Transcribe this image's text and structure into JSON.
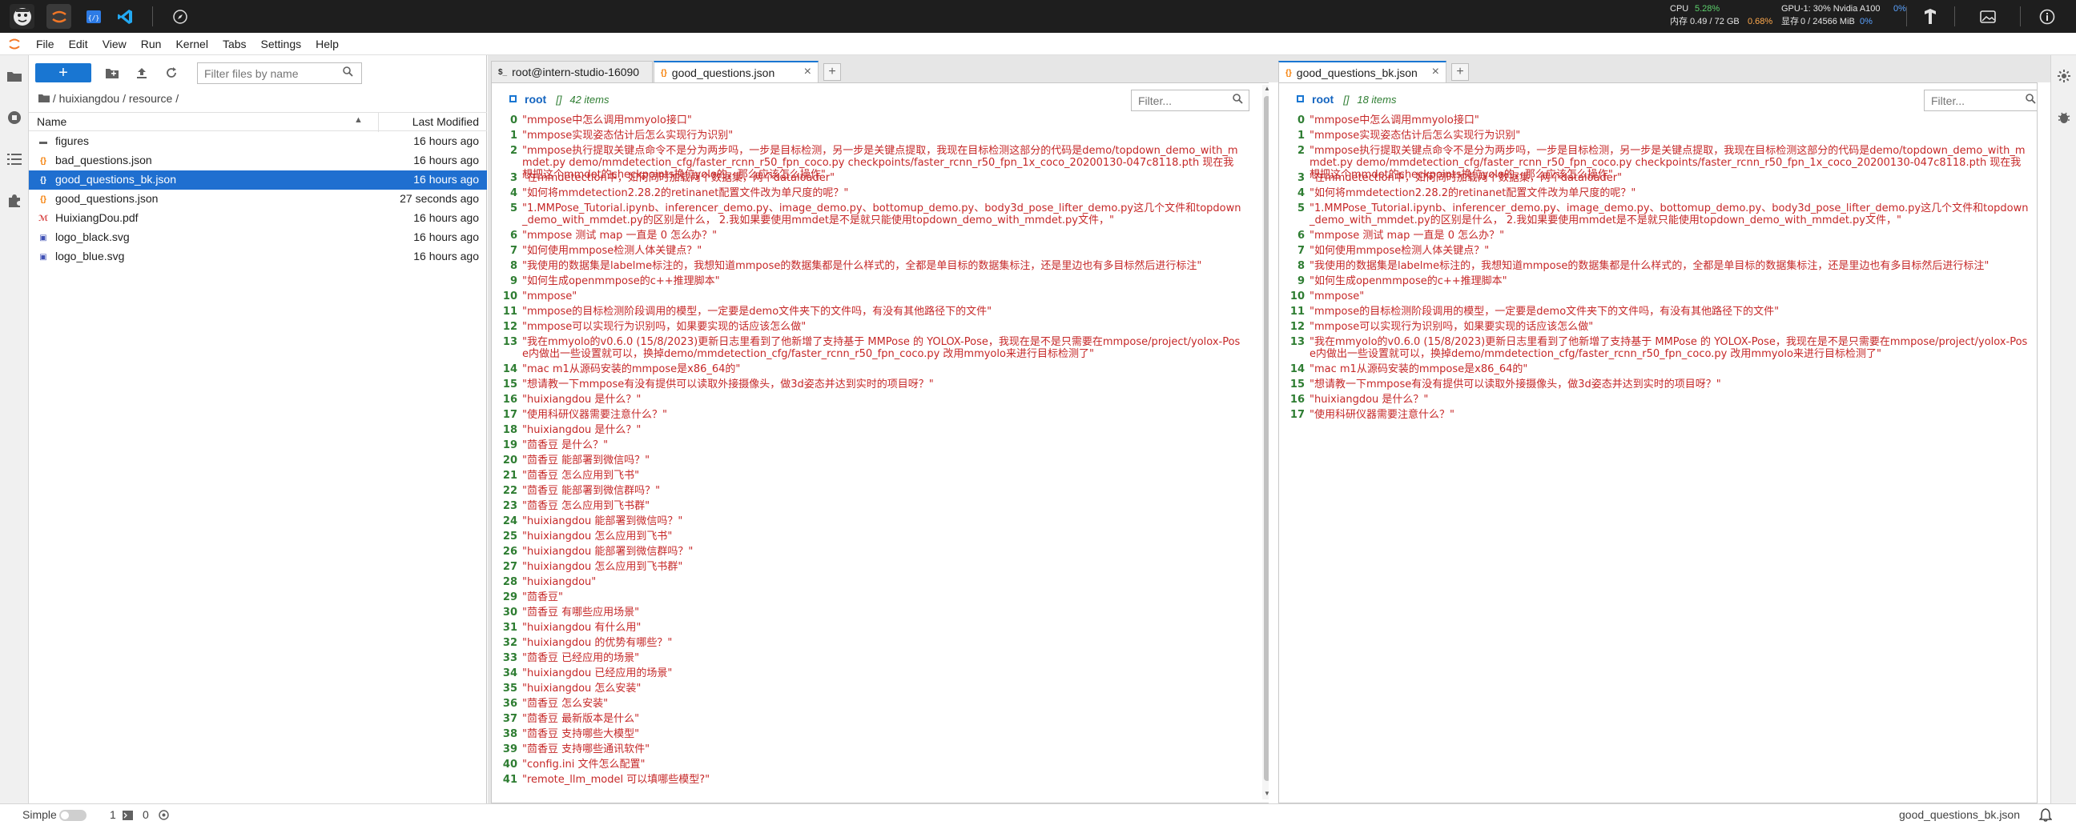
{
  "system_stats": {
    "cpu_label": "CPU",
    "cpu_value": "5.28%",
    "mem_label": "内存",
    "mem_value": "0.49 / 72 GB",
    "mem_percent": "0.68%",
    "gpu_label": "GPU-1: 30% Nvidia A100",
    "gpu_percent": "0%",
    "vram_label": "显存",
    "vram_value": "0 / 24566 MiB",
    "vram_percent": "0%"
  },
  "menu": [
    "File",
    "Edit",
    "View",
    "Run",
    "Kernel",
    "Tabs",
    "Settings",
    "Help"
  ],
  "file_browser": {
    "new_label": "+",
    "filter_placeholder": "Filter files by name",
    "breadcrumb": "/ huixiangdou / resource /",
    "col_name": "Name",
    "col_modified": "Last Modified",
    "files": [
      {
        "name": "figures",
        "modified": "16 hours ago",
        "icon": "folder-icon",
        "glyph": "▬"
      },
      {
        "name": "bad_questions.json",
        "modified": "16 hours ago",
        "icon": "json-file-icon",
        "glyph": "{}"
      },
      {
        "name": "good_questions_bk.json",
        "modified": "16 hours ago",
        "icon": "json-file-icon",
        "glyph": "{}"
      },
      {
        "name": "good_questions.json",
        "modified": "27 seconds ago",
        "icon": "json-file-icon",
        "glyph": "{}"
      },
      {
        "name": "HuixiangDou.pdf",
        "modified": "16 hours ago",
        "icon": "pdf-file-icon",
        "glyph": "ℳ"
      },
      {
        "name": "logo_black.svg",
        "modified": "16 hours ago",
        "icon": "image-file-icon",
        "glyph": "▣"
      },
      {
        "name": "logo_blue.svg",
        "modified": "16 hours ago",
        "icon": "image-file-icon",
        "glyph": "▣"
      }
    ]
  },
  "left_panel": {
    "tabs": [
      {
        "label": "root@intern-studio-16090",
        "icon": "$_"
      },
      {
        "label": "good_questions.json",
        "icon": "{}"
      }
    ],
    "filter_placeholder": "Filter...",
    "root_key": "root",
    "root_type": "[]",
    "root_count": "42 items",
    "items": [
      {
        "k": "0",
        "v": "\"mmpose中怎么调用mmyolo接口\""
      },
      {
        "k": "1",
        "v": "\"mmpose实现姿态估计后怎么实现行为识别\""
      },
      {
        "k": "2",
        "v": "\"mmpose执行提取关键点命令不是分为两步吗，一步是目标检测，另一步是关键点提取，我现在目标检测这部分的代码是demo/topdown_demo_with_mmdet.py demo/mmdetection_cfg/faster_rcnn_r50_fpn_coco.py checkpoints/faster_rcnn_r50_fpn_1x_coco_20200130-047c8118.pth 现在我想把这个mmdet的checkpoints换位yolo的，那么应该怎么操作\""
      },
      {
        "k": "3",
        "v": "\"在mmdetection中，如何同时加载两个数据集，两个dataloader\""
      },
      {
        "k": "4",
        "v": "\"如何将mmdetection2.28.2的retinanet配置文件改为单尺度的呢？\""
      },
      {
        "k": "5",
        "v": "\"1.MMPose_Tutorial.ipynb、inferencer_demo.py、image_demo.py、bottomup_demo.py、body3d_pose_lifter_demo.py这几个文件和topdown_demo_with_mmdet.py的区别是什么， 2.我如果要使用mmdet是不是就只能使用topdown_demo_with_mmdet.py文件，\""
      },
      {
        "k": "6",
        "v": "\"mmpose 测试 map 一直是 0 怎么办？\""
      },
      {
        "k": "7",
        "v": "\"如何使用mmpose检测人体关键点？\""
      },
      {
        "k": "8",
        "v": "\"我使用的数据集是labelme标注的，我想知道mmpose的数据集都是什么样式的，全都是单目标的数据集标注，还是里边也有多目标然后进行标注\""
      },
      {
        "k": "9",
        "v": "\"如何生成openmmpose的c++推理脚本\""
      },
      {
        "k": "10",
        "v": "\"mmpose\""
      },
      {
        "k": "11",
        "v": "\"mmpose的目标检测阶段调用的模型，一定要是demo文件夹下的文件吗，有没有其他路径下的文件\""
      },
      {
        "k": "12",
        "v": "\"mmpose可以实现行为识别吗，如果要实现的话应该怎么做\""
      },
      {
        "k": "13",
        "v": "\"我在mmyolo的v0.6.0 (15/8/2023)更新日志里看到了他新增了支持基于 MMPose 的 YOLOX-Pose，我现在是不是只需要在mmpose/project/yolox-Pose内做出一些设置就可以，换掉demo/mmdetection_cfg/faster_rcnn_r50_fpn_coco.py 改用mmyolo来进行目标检测了\""
      },
      {
        "k": "14",
        "v": "\"mac m1从源码安装的mmpose是x86_64的\""
      },
      {
        "k": "15",
        "v": "\"想请教一下mmpose有没有提供可以读取外接摄像头，做3d姿态并达到实时的项目呀？\""
      },
      {
        "k": "16",
        "v": "\"huixiangdou 是什么？\""
      },
      {
        "k": "17",
        "v": "\"使用科研仪器需要注意什么？\""
      },
      {
        "k": "18",
        "v": "\"huixiangdou 是什么？\""
      },
      {
        "k": "19",
        "v": "\"茴香豆 是什么？\""
      },
      {
        "k": "20",
        "v": "\"茴香豆 能部署到微信吗？\""
      },
      {
        "k": "21",
        "v": "\"茴香豆 怎么应用到飞书\""
      },
      {
        "k": "22",
        "v": "\"茴香豆 能部署到微信群吗？\""
      },
      {
        "k": "23",
        "v": "\"茴香豆 怎么应用到飞书群\""
      },
      {
        "k": "24",
        "v": "\"huixiangdou 能部署到微信吗？\""
      },
      {
        "k": "25",
        "v": "\"huixiangdou 怎么应用到飞书\""
      },
      {
        "k": "26",
        "v": "\"huixiangdou 能部署到微信群吗？\""
      },
      {
        "k": "27",
        "v": "\"huixiangdou 怎么应用到飞书群\""
      },
      {
        "k": "28",
        "v": "\"huixiangdou\""
      },
      {
        "k": "29",
        "v": "\"茴香豆\""
      },
      {
        "k": "30",
        "v": "\"茴香豆 有哪些应用场景\""
      },
      {
        "k": "31",
        "v": "\"huixiangdou 有什么用\""
      },
      {
        "k": "32",
        "v": "\"huixiangdou 的优势有哪些？\""
      },
      {
        "k": "33",
        "v": "\"茴香豆 已经应用的场景\""
      },
      {
        "k": "34",
        "v": "\"huixiangdou 已经应用的场景\""
      },
      {
        "k": "35",
        "v": "\"huixiangdou 怎么安装\""
      },
      {
        "k": "36",
        "v": "\"茴香豆 怎么安装\""
      },
      {
        "k": "37",
        "v": "\"茴香豆 最新版本是什么\""
      },
      {
        "k": "38",
        "v": "\"茴香豆 支持哪些大模型\""
      },
      {
        "k": "39",
        "v": "\"茴香豆 支持哪些通讯软件\""
      },
      {
        "k": "40",
        "v": "\"config.ini 文件怎么配置\""
      },
      {
        "k": "41",
        "v": "\"remote_llm_model 可以填哪些模型?\""
      }
    ]
  },
  "right_panel": {
    "tabs": [
      {
        "label": "good_questions_bk.json",
        "icon": "{}"
      }
    ],
    "filter_placeholder": "Filter...",
    "root_key": "root",
    "root_type": "[]",
    "root_count": "18 items",
    "items": [
      {
        "k": "0",
        "v": "\"mmpose中怎么调用mmyolo接口\""
      },
      {
        "k": "1",
        "v": "\"mmpose实现姿态估计后怎么实现行为识别\""
      },
      {
        "k": "2",
        "v": "\"mmpose执行提取关键点命令不是分为两步吗，一步是目标检测，另一步是关键点提取，我现在目标检测这部分的代码是demo/topdown_demo_with_mmdet.py demo/mmdetection_cfg/faster_rcnn_r50_fpn_coco.py checkpoints/faster_rcnn_r50_fpn_1x_coco_20200130-047c8118.pth 现在我想把这个mmdet的checkpoints换位yolo的，那么应该怎么操作\""
      },
      {
        "k": "3",
        "v": "\"在mmdetection中，如何同时加载两个数据集，两个dataloader\""
      },
      {
        "k": "4",
        "v": "\"如何将mmdetection2.28.2的retinanet配置文件改为单尺度的呢？\""
      },
      {
        "k": "5",
        "v": "\"1.MMPose_Tutorial.ipynb、inferencer_demo.py、image_demo.py、bottomup_demo.py、body3d_pose_lifter_demo.py这几个文件和topdown_demo_with_mmdet.py的区别是什么， 2.我如果要使用mmdet是不是就只能使用topdown_demo_with_mmdet.py文件，\""
      },
      {
        "k": "6",
        "v": "\"mmpose 测试 map 一直是 0 怎么办？\""
      },
      {
        "k": "7",
        "v": "\"如何使用mmpose检测人体关键点？\""
      },
      {
        "k": "8",
        "v": "\"我使用的数据集是labelme标注的，我想知道mmpose的数据集都是什么样式的，全都是单目标的数据集标注，还是里边也有多目标然后进行标注\""
      },
      {
        "k": "9",
        "v": "\"如何生成openmmpose的c++推理脚本\""
      },
      {
        "k": "10",
        "v": "\"mmpose\""
      },
      {
        "k": "11",
        "v": "\"mmpose的目标检测阶段调用的模型，一定要是demo文件夹下的文件吗，有没有其他路径下的文件\""
      },
      {
        "k": "12",
        "v": "\"mmpose可以实现行为识别吗，如果要实现的话应该怎么做\""
      },
      {
        "k": "13",
        "v": "\"我在mmyolo的v0.6.0 (15/8/2023)更新日志里看到了他新增了支持基于 MMPose 的 YOLOX-Pose，我现在是不是只需要在mmpose/project/yolox-Pose内做出一些设置就可以，换掉demo/mmdetection_cfg/faster_rcnn_r50_fpn_coco.py 改用mmyolo来进行目标检测了\""
      },
      {
        "k": "14",
        "v": "\"mac m1从源码安装的mmpose是x86_64的\""
      },
      {
        "k": "15",
        "v": "\"想请教一下mmpose有没有提供可以读取外接摄像头，做3d姿态并达到实时的项目呀？\""
      },
      {
        "k": "16",
        "v": "\"huixiangdou 是什么？\""
      },
      {
        "k": "17",
        "v": "\"使用科研仪器需要注意什么？\""
      }
    ]
  },
  "status_bar": {
    "mode_label": "Simple",
    "kernels_count": "1",
    "terminals_count": "0",
    "current_file": "good_questions_bk.json"
  }
}
